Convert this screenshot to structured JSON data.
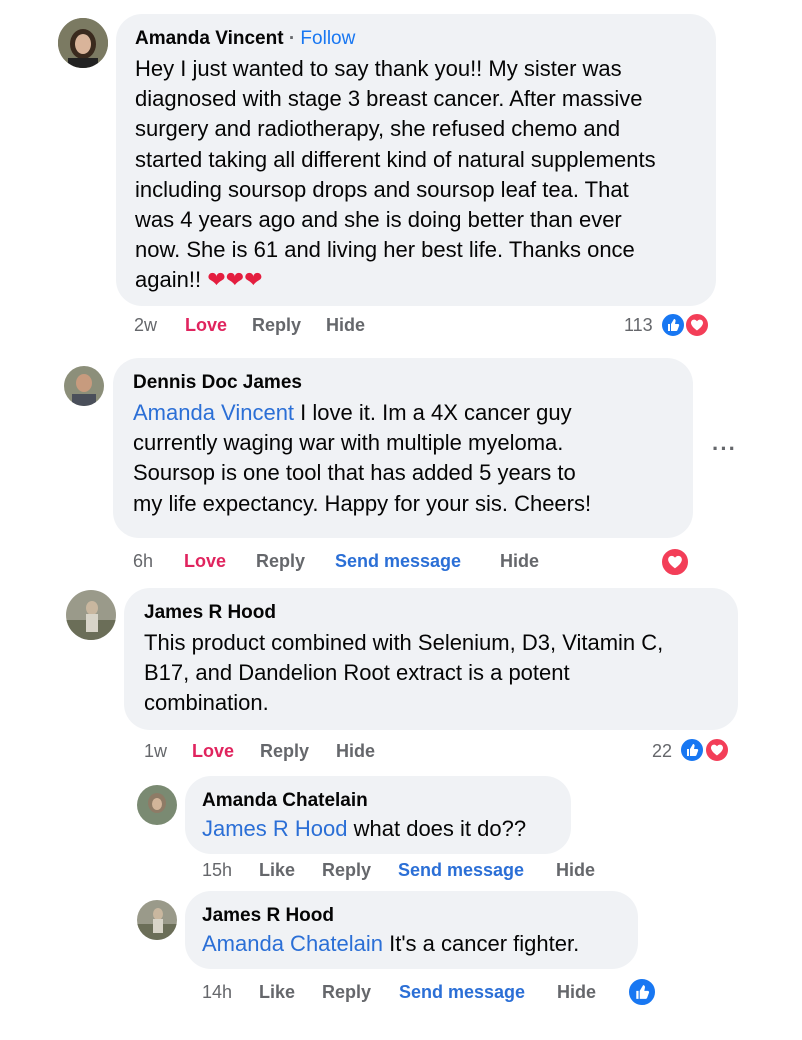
{
  "comments": [
    {
      "author": "Amanda Vincent",
      "separator": "·",
      "follow_label": "Follow",
      "lines": [
        "Hey I just wanted to say thank you!! My sister was",
        "diagnosed with stage 3 breast cancer. After massive",
        "surgery and radiotherapy, she refused chemo and",
        "started taking all different kind of natural supplements",
        "including soursop drops and soursop leaf tea. That",
        "was 4 years ago and she is doing better than ever",
        "now. She is 61 and living her best life. Thanks once"
      ],
      "last_line": "again!!",
      "time": "2w",
      "love": "Love",
      "reply": "Reply",
      "hide": "Hide",
      "reaction_count": "113",
      "reactions": [
        "like-icon",
        "love-icon"
      ]
    },
    {
      "author": "Dennis Doc James",
      "mention": "Amanda Vincent",
      "first_line_rest": " I love it. Im a 4X cancer guy",
      "lines": [
        "currently waging war with multiple myeloma.",
        "Soursop is one tool that has added 5 years to",
        "my life expectancy. Happy for your sis. Cheers!"
      ],
      "time": "6h",
      "love": "Love",
      "reply": "Reply",
      "send_message": "Send message",
      "hide": "Hide",
      "more_label": "···",
      "reactions": [
        "love-icon"
      ]
    },
    {
      "author": "James R Hood",
      "lines": [
        "This product combined with Selenium, D3, Vitamin C,",
        "B17, and Dandelion Root extract is a potent",
        "combination."
      ],
      "time": "1w",
      "love": "Love",
      "reply": "Reply",
      "hide": "Hide",
      "reaction_count": "22",
      "reactions": [
        "like-icon",
        "love-icon"
      ]
    }
  ],
  "replies": [
    {
      "author": "Amanda Chatelain",
      "mention": "James R Hood",
      "text": " what does it do??",
      "time": "15h",
      "like": "Like",
      "reply": "Reply",
      "send_message": "Send message",
      "hide": "Hide"
    },
    {
      "author": "James R Hood",
      "mention": "Amanda Chatelain",
      "text": " It's a cancer fighter.",
      "time": "14h",
      "like": "Like",
      "reply": "Reply",
      "send_message": "Send message",
      "hide": "Hide",
      "reactions": [
        "like-icon"
      ]
    }
  ],
  "colors": {
    "bubble": "#f0f2f5",
    "mention": "#2b6fd6",
    "love": "#e0245e",
    "like_blue": "#1877f2",
    "love_red": "#f33e58"
  }
}
